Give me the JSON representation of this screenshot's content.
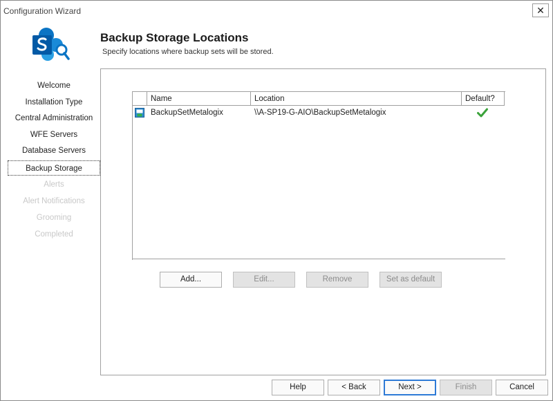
{
  "window": {
    "title": "Configuration Wizard",
    "close_glyph": "✕"
  },
  "header": {
    "title": "Backup Storage Locations",
    "subtitle": "Specify locations where backup sets will be stored."
  },
  "nav": {
    "items": [
      {
        "label": "Welcome",
        "state": "enabled"
      },
      {
        "label": "Installation Type",
        "state": "enabled"
      },
      {
        "label": "Central Administration",
        "state": "enabled"
      },
      {
        "label": "WFE Servers",
        "state": "enabled"
      },
      {
        "label": "Database Servers",
        "state": "enabled"
      },
      {
        "label": "Backup Storage",
        "state": "active"
      },
      {
        "label": "Alerts",
        "state": "disabled"
      },
      {
        "label": "Alert Notifications",
        "state": "disabled"
      },
      {
        "label": "Grooming",
        "state": "disabled"
      },
      {
        "label": "Completed",
        "state": "disabled"
      }
    ]
  },
  "grid": {
    "columns": {
      "name": "Name",
      "location": "Location",
      "default": "Default?"
    },
    "rows": [
      {
        "icon": "storage-icon",
        "name": "BackupSetMetalogix",
        "location": "\\\\A-SP19-G-AIO\\BackupSetMetalogix",
        "is_default": true
      }
    ]
  },
  "actions": {
    "add": "Add...",
    "edit": "Edit...",
    "remove": "Remove",
    "set_default": "Set as default"
  },
  "footer": {
    "help": "Help",
    "back": "< Back",
    "next": "Next >",
    "finish": "Finish",
    "cancel": "Cancel"
  },
  "colors": {
    "accent": "#2d7ad6",
    "sharepoint_blue": "#0b74c4",
    "default_check": "#3aa23a"
  }
}
